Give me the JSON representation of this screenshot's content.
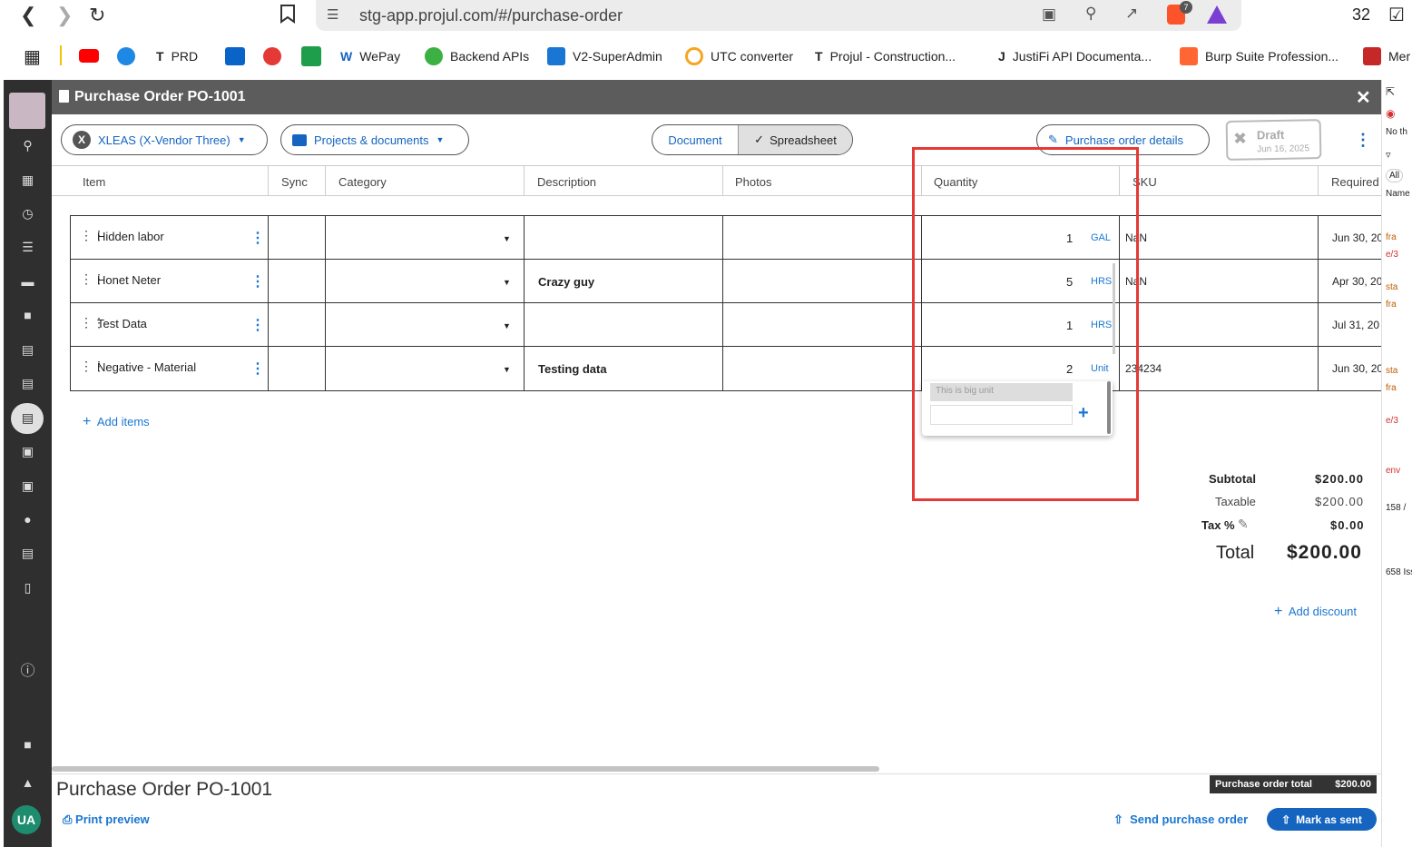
{
  "browser": {
    "url": "stg-app.projul.com/#/purchase-order",
    "tab_count": "32",
    "brave_badge": "7",
    "bookmarks": [
      "PRD",
      "WePay",
      "Backend APIs",
      "V2-SuperAdmin",
      "UTC converter",
      "Projul - Construction...",
      "JustiFi API Documenta...",
      "Burp Suite Profession...",
      "Mer"
    ]
  },
  "window": {
    "title": "Purchase Order PO-1001"
  },
  "toolbar": {
    "vendor": "XLEAS (X-Vendor Three)",
    "projects": "Projects & documents",
    "view_document": "Document",
    "view_spreadsheet": "Spreadsheet",
    "po_details": "Purchase order details",
    "status": "Draft",
    "status_date": "Jun 16, 2025"
  },
  "table": {
    "headers": [
      "Item",
      "Sync",
      "Category",
      "Description",
      "Photos",
      "Quantity",
      "SKU",
      "Required"
    ],
    "rows": [
      {
        "item": "Hidden labor",
        "description": "",
        "qty": "1",
        "unit": "GAL",
        "sku": "NaN",
        "required": "Jun 30, 20"
      },
      {
        "item": "Honet Neter",
        "description": "Crazy guy",
        "qty": "5",
        "unit": "HRS",
        "sku": "NaN",
        "required": "Apr 30, 20"
      },
      {
        "item": "Test Data",
        "description": "",
        "qty": "1",
        "unit": "HRS",
        "sku": "",
        "required": "Jul 31, 20"
      },
      {
        "item": "Negative - Material",
        "description": "Testing data",
        "qty": "2",
        "unit": "Unit",
        "sku": "234234",
        "required": "Jun 30, 20"
      }
    ],
    "add_items": "Add items",
    "dropdown_partial": "This is big unit"
  },
  "totals": {
    "subtotal_label": "Subtotal",
    "subtotal": "$200.00",
    "taxable_label": "Taxable",
    "taxable": "$200.00",
    "tax_label": "Tax %",
    "tax": "$0.00",
    "total_label": "Total",
    "total": "$200.00",
    "add_discount": "Add discount"
  },
  "footer": {
    "title": "Purchase Order  PO-1001",
    "po_total_label": "Purchase order total",
    "po_total": "$200.00",
    "print_preview": "Print preview",
    "send": "Send purchase order",
    "mark_sent": "Mark as sent"
  },
  "user": {
    "initials": "UA"
  },
  "devtools": {
    "filter_all": "All",
    "name_col": "Name",
    "no_throttle": "No th",
    "count": "158 /",
    "issues": "658 Iss",
    "entries": [
      "fra",
      "e/3",
      "sta",
      "fra",
      "sta",
      "fra",
      "e/3",
      "env"
    ]
  },
  "colors": {
    "accent": "#1976d2",
    "highlight": "#e53935",
    "titlebar": "#5c5c5c",
    "sidebar": "#2f2f2f"
  }
}
